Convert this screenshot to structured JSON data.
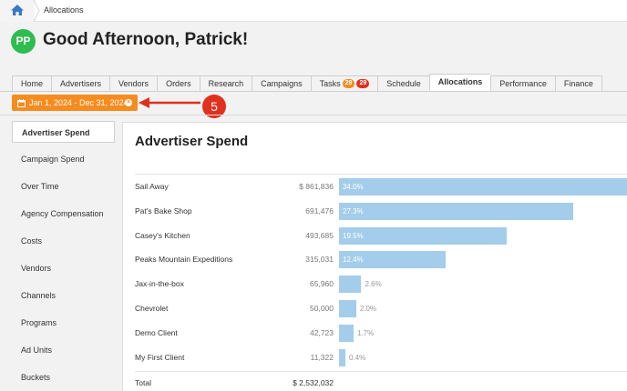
{
  "breadcrumb": {
    "home_icon": "home-icon",
    "current": "Allocations"
  },
  "user": {
    "initials": "PP",
    "greeting": "Good Afternoon, Patrick!",
    "avatar_color": "#2dbd4f"
  },
  "tabs": [
    {
      "label": "Home",
      "active": false
    },
    {
      "label": "Advertisers",
      "active": false
    },
    {
      "label": "Vendors",
      "active": false
    },
    {
      "label": "Orders",
      "active": false
    },
    {
      "label": "Research",
      "active": false
    },
    {
      "label": "Campaigns",
      "active": false
    },
    {
      "label": "Tasks",
      "active": false,
      "badges": [
        {
          "value": "29",
          "color": "#f68b1f"
        },
        {
          "value": "29",
          "color": "#e0301e"
        }
      ]
    },
    {
      "label": "Schedule",
      "active": false
    },
    {
      "label": "Allocations",
      "active": true
    },
    {
      "label": "Performance",
      "active": false
    },
    {
      "label": "Finance",
      "active": false
    }
  ],
  "date_filter": {
    "label": "Jan 1, 2024 - Dec 31, 2024",
    "color": "#f68b1f"
  },
  "callout": {
    "number": "5",
    "color": "#e0301e"
  },
  "sidebar": {
    "items": [
      {
        "label": "Advertiser Spend",
        "active": true
      },
      {
        "label": "Campaign Spend",
        "active": false
      },
      {
        "label": "Over Time",
        "active": false
      },
      {
        "label": "Agency Compensation",
        "active": false
      },
      {
        "label": "Costs",
        "active": false
      },
      {
        "label": "Vendors",
        "active": false
      },
      {
        "label": "Channels",
        "active": false
      },
      {
        "label": "Programs",
        "active": false
      },
      {
        "label": "Ad Units",
        "active": false
      },
      {
        "label": "Buckets",
        "active": false
      }
    ]
  },
  "main": {
    "title": "Advertiser Spend",
    "bar_color": "#a3cdea",
    "rows": [
      {
        "name": "Sail Away",
        "amount": "$ 861,836",
        "percent": 34.0,
        "percent_label": "34.0%"
      },
      {
        "name": "Pat's Bake Shop",
        "amount": "691,476",
        "percent": 27.3,
        "percent_label": "27.3%"
      },
      {
        "name": "Casey's Kitchen",
        "amount": "493,685",
        "percent": 19.5,
        "percent_label": "19.5%"
      },
      {
        "name": "Peaks Mountain Expeditions",
        "amount": "315,031",
        "percent": 12.4,
        "percent_label": "12.4%"
      },
      {
        "name": "Jax-in-the-box",
        "amount": "65,960",
        "percent": 2.6,
        "percent_label": "2.6%"
      },
      {
        "name": "Chevrolet",
        "amount": "50,000",
        "percent": 2.0,
        "percent_label": "2.0%"
      },
      {
        "name": "Demo Client",
        "amount": "42,723",
        "percent": 1.7,
        "percent_label": "1.7%"
      },
      {
        "name": "My First Client",
        "amount": "11,322",
        "percent": 0.4,
        "percent_label": "0.4%"
      }
    ],
    "total": {
      "name": "Total",
      "amount": "$ 2,532,032"
    }
  }
}
